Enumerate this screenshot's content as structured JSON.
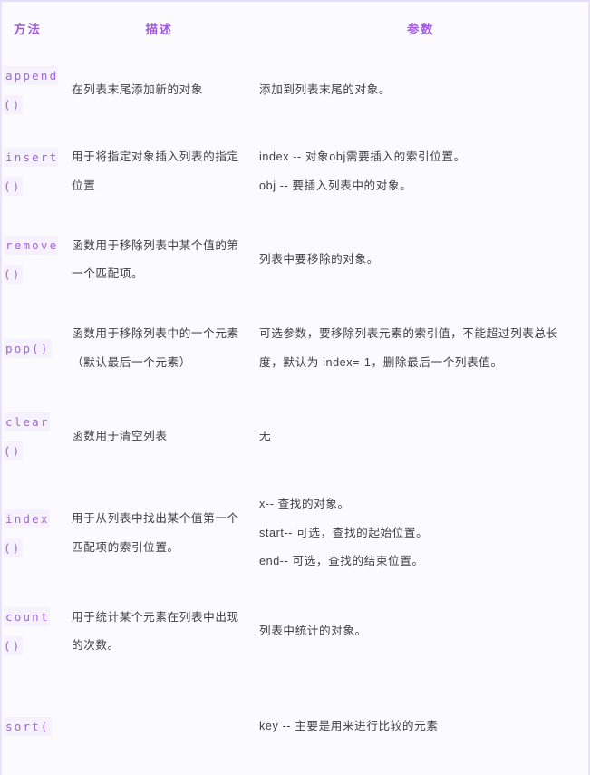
{
  "table": {
    "headers": {
      "method": "方法",
      "description": "描述",
      "parameters": "参数"
    },
    "rows": [
      {
        "method": "append()",
        "description": "在列表末尾添加新的对象",
        "parameters": [
          "添加到列表末尾的对象。"
        ]
      },
      {
        "method": "insert()",
        "description": "用于将指定对象插入列表的指定位置",
        "parameters": [
          "index -- 对象obj需要插入的索引位置。",
          "obj -- 要插入列表中的对象。"
        ]
      },
      {
        "method": "remove()",
        "description": "函数用于移除列表中某个值的第一个匹配项。",
        "parameters": [
          "列表中要移除的对象。"
        ]
      },
      {
        "method": "pop()",
        "description": "函数用于移除列表中的一个元素（默认最后一个元素）",
        "parameters": [
          "可选参数，要移除列表元素的索引值，不能超过列表总长度，默认为 index=-1，删除最后一个列表值。"
        ]
      },
      {
        "method": "clear()",
        "description": "函数用于清空列表",
        "parameters": [
          "无"
        ]
      },
      {
        "method": "index()",
        "description": "用于从列表中找出某个值第一个匹配项的索引位置。",
        "parameters": [
          "x-- 查找的对象。",
          "start-- 可选，查找的起始位置。",
          "end-- 可选，查找的结束位置。"
        ]
      },
      {
        "method": "count()",
        "description": "用于统计某个元素在列表中出现的次数。",
        "parameters": [
          "列表中统计的对象。"
        ]
      },
      {
        "method": "sort(",
        "description": "",
        "parameters": [
          "key -- 主要是用来进行比较的元素"
        ]
      }
    ]
  },
  "colors": {
    "header_text": "#a05ae0",
    "code_text": "#a366d9",
    "code_background": "#f5f1fd",
    "body_text": "#3f4045",
    "page_background": "#fbfaff",
    "border": "#e9e2fb"
  }
}
